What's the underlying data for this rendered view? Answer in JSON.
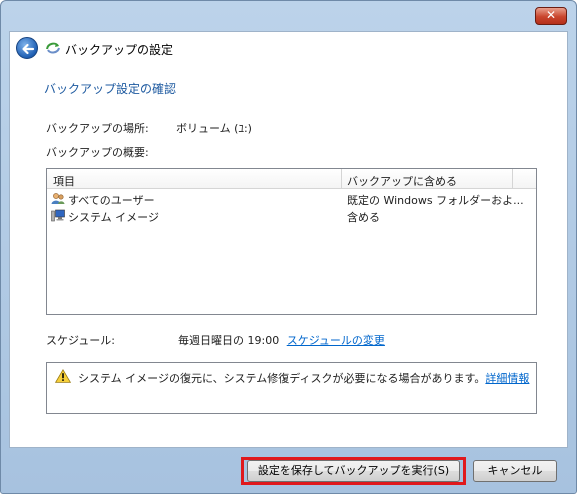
{
  "window": {
    "close_label": "✕"
  },
  "header": {
    "title": "バックアップの設定",
    "back_icon": "back-arrow-icon",
    "app_icon": "backup-icon"
  },
  "main": {
    "section_title": "バックアップ設定の確認",
    "location_label": "バックアップの場所:",
    "location_value": "ボリューム (ﾕ:)",
    "summary_label": "バックアップの概要:",
    "table": {
      "columns": [
        "項目",
        "バックアップに含める"
      ],
      "rows": [
        {
          "icon": "users-icon",
          "item": "すべてのユーザー",
          "include": "既定の Windows フォルダーおよ..."
        },
        {
          "icon": "system-image-icon",
          "item": "システム イメージ",
          "include": "含める"
        }
      ]
    },
    "schedule_label": "スケジュール:",
    "schedule_value": "毎週日曜日の 19:00",
    "schedule_link": "スケジュールの変更",
    "info": {
      "icon": "warning-icon",
      "text": "システム イメージの復元に、システム修復ディスクが必要になる場合があります。",
      "link": "詳細情報"
    }
  },
  "buttons": {
    "save_run": "設定を保存してバックアップを実行(S)",
    "cancel": "キャンセル"
  },
  "colors": {
    "highlight": "#e0191d",
    "link": "#0066cc",
    "section_title": "#1e5aa0"
  }
}
